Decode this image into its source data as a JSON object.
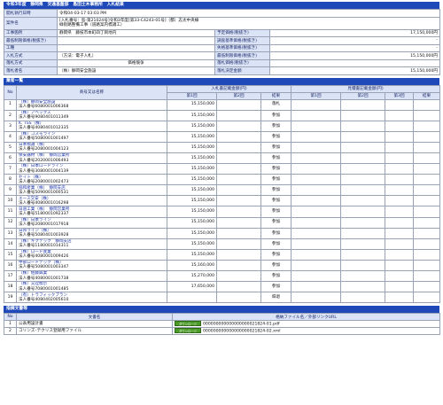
{
  "page_title": "令和3年度　静岡県　交通基盤部　島田土木事務所　入札結果",
  "info": {
    "kaisatsu_label": "開札執行日時",
    "kaisatsu_value": "令和04-03-17 03:03 PM",
    "anken_label": "案件名",
    "anken_line1": "[入札番号：島-第2102​4号]令和3年度[第33-C4243-01号]（都）志太中央線",
    "anken_line2": "緑街路整備工事（道路案内標識工）",
    "site_label": "工事箇所",
    "site_value": "静岡県　藤枝市本町四丁目地内",
    "yotei_label": "予定価格(税抜き)",
    "yotei_value": "17,150,000円",
    "saitei_label": "最低制限価格(税抜き)",
    "saitei_value": "",
    "chosa_label": "調査基準価格(税抜き)",
    "chosa_value": "-",
    "shikkaku_label": "失格基準価格(税抜き)",
    "shikkaku_value": "-",
    "method_label": "入札方式",
    "method_value": "（方法：電子入札）",
    "rakusatsu_label": "落札方式",
    "rakusatsu_value": "価格競争",
    "saiteinyu_label": "最低制限価格(税抜き)",
    "saiteinyu_value": "15,150,000円",
    "kishu_label": "落札者名",
    "kishu_value": "（株）静岡安全施設",
    "kakaku_label": "落札価格(税抜き)",
    "kakaku_value": "",
    "kettei_label": "落札決定金額",
    "kettei_value": "15,150,000円",
    "blank_label": "工種",
    "blank_label2": "工種"
  },
  "bidders_section": "業者一覧",
  "bidders_header": {
    "no": "No",
    "name": "商号又は名称",
    "bid_group": "入札書記載金額(円)",
    "renew_group": "見積書記載金額(円)",
    "r1": "第1回",
    "r2": "第2回",
    "r3": "第3回",
    "result": "結果"
  },
  "bidders": [
    {
      "no": "1",
      "name": "（株）静岡安全施設",
      "id": "法人番号6080001006368",
      "amt": "15,150,000",
      "res": "落札"
    },
    {
      "no": "2",
      "name": "（株）アベックス",
      "id": "法人番号9080401011349",
      "amt": "15,150,000",
      "res": "参加"
    },
    {
      "no": "3",
      "name": "K. TSS（株）",
      "id": "法人番号4080401012335",
      "amt": "15,150,000",
      "res": "参加"
    },
    {
      "no": "4",
      "name": "（株）コスモライン",
      "id": "法人番号5080001001497",
      "amt": "15,150,000",
      "res": "参加"
    },
    {
      "no": "5",
      "name": "日本標識（株）",
      "id": "法人番号2080001004123",
      "amt": "15,150,000",
      "res": "参加"
    },
    {
      "no": "6",
      "name": "保安器材（株）　静岡営業所",
      "id": "法人番号2020001006493",
      "amt": "15,150,000",
      "res": "参加"
    },
    {
      "no": "7",
      "name": "（株）日本ロードライン",
      "id": "法人番号3080001004139",
      "amt": "15,150,000",
      "res": "参加"
    },
    {
      "no": "8",
      "name": "セイト（株）",
      "id": "法人番号2080001002473",
      "amt": "15,150,000",
      "res": "参加"
    },
    {
      "no": "9",
      "name": "協和産業（株）　静岡支店",
      "id": "法人番号5090001000531",
      "amt": "15,150,000",
      "res": "参加"
    },
    {
      "no": "10",
      "name": "エース交安（株）",
      "id": "法人番号4080001016298",
      "amt": "15,150,000",
      "res": "参加"
    },
    {
      "no": "11",
      "name": "日道工業（株）　静岡営業所",
      "id": "法人番号5180001092337",
      "amt": "15,150,000",
      "res": "参加"
    },
    {
      "no": "12",
      "name": "（株）日本ライン",
      "id": "法人番号2080001017918",
      "amt": "15,150,000",
      "res": "参加"
    },
    {
      "no": "13",
      "name": "日邦ライン（株）",
      "id": "法人番号5080401003928",
      "amt": "15,150,000",
      "res": "参加"
    },
    {
      "no": "14",
      "name": "（株）キクテック　静岡支店",
      "id": "法人番号1180001014311",
      "amt": "15,150,000",
      "res": "参加"
    },
    {
      "no": "15",
      "name": "（株）ロード産業",
      "id": "法人番号4080001009426",
      "amt": "15,150,000",
      "res": "参加"
    },
    {
      "no": "16",
      "name": "中部ロードテック（株）",
      "id": "法人番号5080001003347",
      "amt": "15,160,000",
      "res": "参加"
    },
    {
      "no": "17",
      "name": "（株）佐藤興業",
      "id": "法人番号4080001001738",
      "amt": "15,270,000",
      "res": "参加"
    },
    {
      "no": "18",
      "name": "（株）交詮標示",
      "id": "法人番号7080001001485",
      "amt": "17,650,000",
      "res": "参加"
    },
    {
      "no": "19",
      "name": "（有）トラフィックプラン",
      "id": "法人番号4080402005610",
      "amt": "",
      "res": "辞退"
    }
  ],
  "docs_section": "指摘文書等",
  "docs_header": {
    "no": "No",
    "name": "文書名",
    "file": "格納ファイル名／外部リンクURL"
  },
  "download_label": "ダウンロード",
  "docs": [
    {
      "no": "1",
      "name": "公表用設計書",
      "file": "000000000000000000021824-01.pdf"
    },
    {
      "no": "2",
      "name": "コリンズ･テクリス登録用ファイル",
      "file": "000000000000000000021824-02.xml"
    }
  ]
}
